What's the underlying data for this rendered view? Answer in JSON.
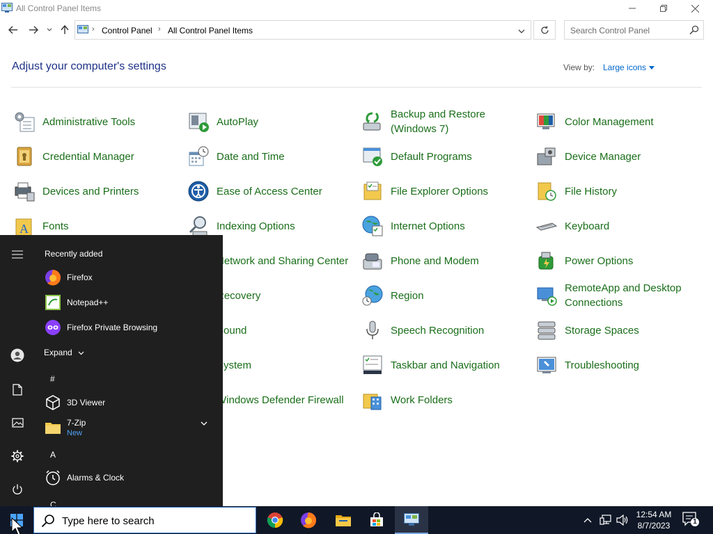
{
  "window": {
    "title": "All Control Panel Items"
  },
  "address_bar": {
    "crumbs": [
      "Control Panel",
      "All Control Panel Items"
    ],
    "search_placeholder": "Search Control Panel"
  },
  "header": {
    "heading": "Adjust your computer's settings",
    "view_by_label": "View by:",
    "view_by_value": "Large icons"
  },
  "items": {
    "administrative_tools": "Administrative Tools",
    "autoplay": "AutoPlay",
    "backup_restore": "Backup and Restore (Windows 7)",
    "color_management": "Color Management",
    "credential_manager": "Credential Manager",
    "date_time": "Date and Time",
    "default_programs": "Default Programs",
    "device_manager": "Device Manager",
    "devices_printers": "Devices and Printers",
    "ease_of_access": "Ease of Access Center",
    "file_explorer_options": "File Explorer Options",
    "file_history": "File History",
    "fonts": "Fonts",
    "indexing_options": "Indexing Options",
    "internet_options": "Internet Options",
    "keyboard": "Keyboard",
    "network_sharing": "Network and Sharing Center",
    "phone_modem": "Phone and Modem",
    "power_options": "Power Options",
    "recovery": "Recovery",
    "region": "Region",
    "remoteapp": "RemoteApp and Desktop Connections",
    "sound": "Sound",
    "speech_recognition": "Speech Recognition",
    "storage_spaces": "Storage Spaces",
    "system": "System",
    "taskbar_navigation": "Taskbar and Navigation",
    "troubleshooting": "Troubleshooting",
    "windows_defender": "Windows Defender Firewall",
    "work_folders": "Work Folders"
  },
  "start_menu": {
    "recently_added_label": "Recently added",
    "recent_apps": [
      "Firefox",
      "Notepad++",
      "Firefox Private Browsing"
    ],
    "expand_label": "Expand",
    "section_hash": "#",
    "app_3d_viewer": "3D Viewer",
    "app_7zip": "7-Zip",
    "app_7zip_badge": "New",
    "section_a": "A",
    "app_alarms": "Alarms & Clock",
    "section_c": "C"
  },
  "taskbar": {
    "search_placeholder": "Type here to search",
    "time": "12:54 AM",
    "date": "8/7/2023",
    "notification_count": "1"
  }
}
